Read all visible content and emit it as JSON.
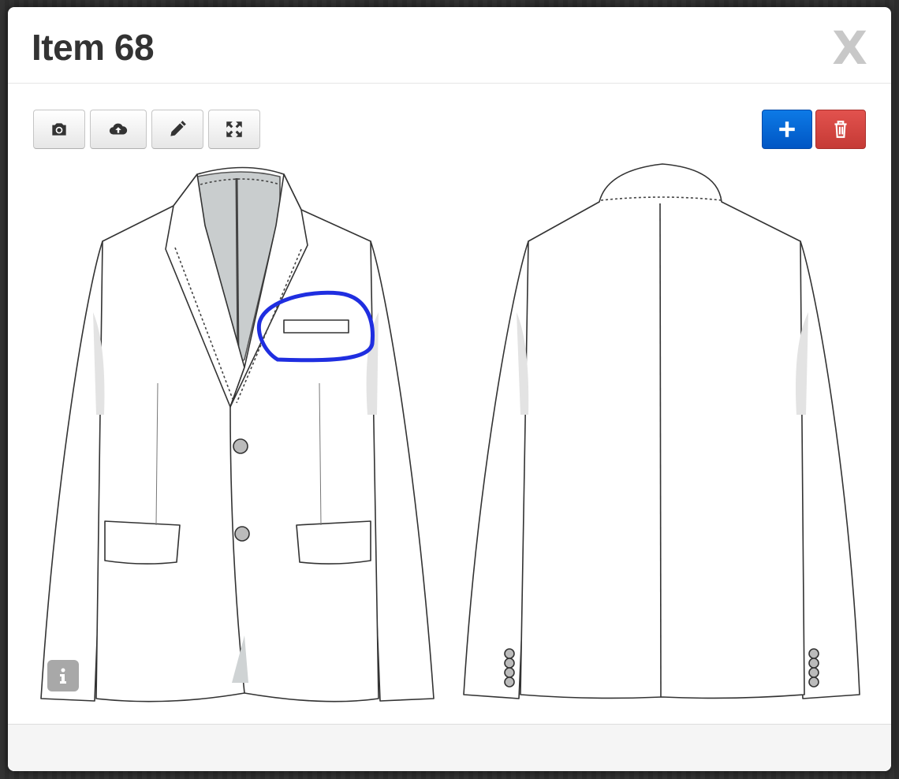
{
  "modal": {
    "title": "Item 68",
    "close_label": "X"
  },
  "toolbar": {
    "left_buttons": [
      {
        "name": "camera-button",
        "icon": "camera-icon"
      },
      {
        "name": "upload-button",
        "icon": "cloud-upload-icon"
      },
      {
        "name": "edit-button",
        "icon": "pencil-icon"
      },
      {
        "name": "fullscreen-button",
        "icon": "expand-icon"
      }
    ],
    "right_buttons": [
      {
        "name": "add-button",
        "icon": "plus-icon",
        "color": "#0d6fdc"
      },
      {
        "name": "delete-button",
        "icon": "trash-icon",
        "color": "#d9534f"
      }
    ]
  },
  "canvas": {
    "annotation_color": "#1f2ee0",
    "info_icon": "info-icon"
  }
}
